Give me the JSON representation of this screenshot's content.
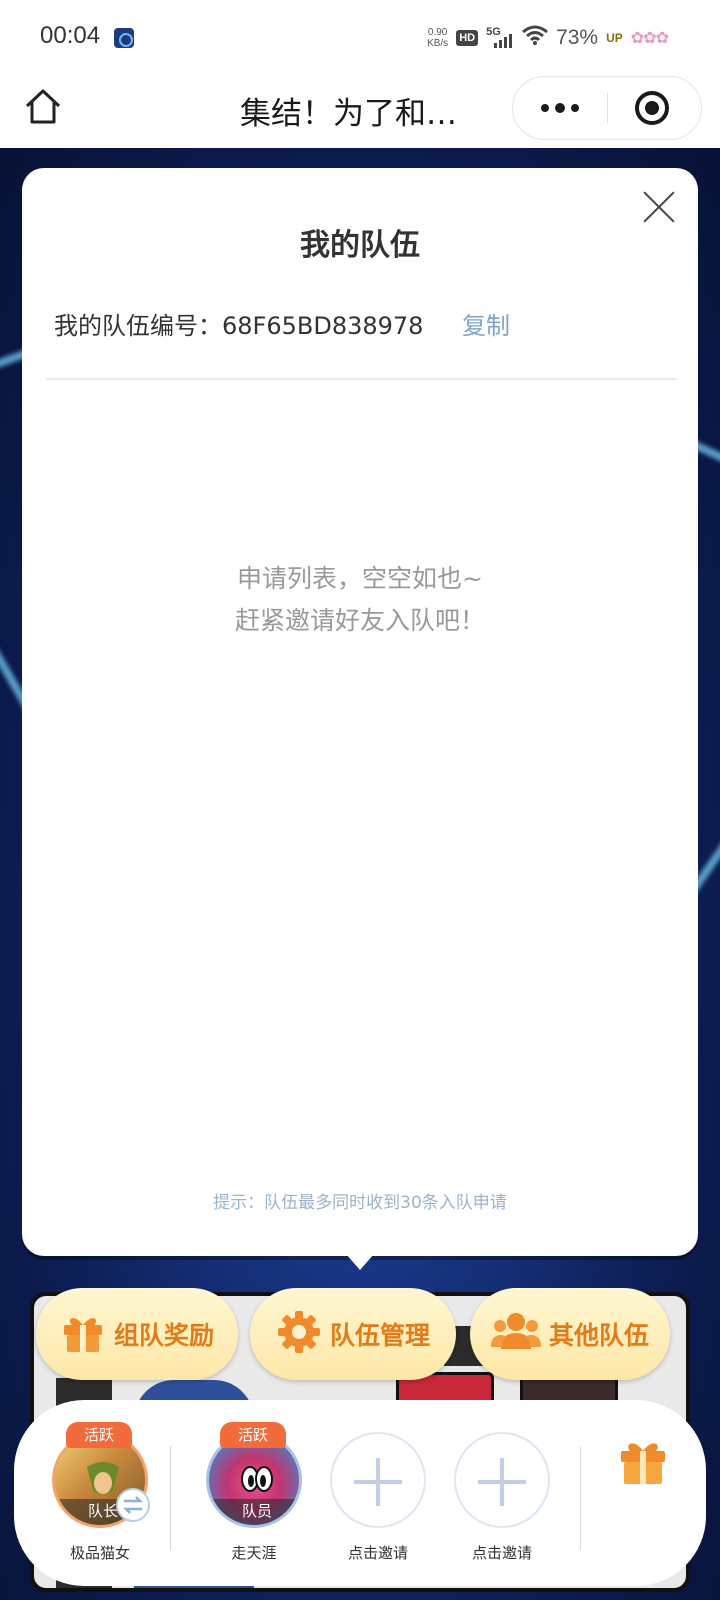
{
  "status_bar": {
    "time": "00:04",
    "net_speed_value": "0.90",
    "net_speed_unit": "KB/s",
    "hd_label": "HD",
    "network_label": "5G",
    "battery": "73%",
    "up_label": "UP"
  },
  "nav": {
    "title": "集结！为了和…",
    "home_icon": "home-icon",
    "more_icon": "more-dots-icon",
    "close_icon": "target-close-icon"
  },
  "modal": {
    "title": "我的队伍",
    "team_number_label": "我的队伍编号：",
    "team_number": "68F65BD838978",
    "copy_label": "复制",
    "empty_line1": "申请列表，空空如也~",
    "empty_line2": "赶紧邀请好友入队吧！",
    "hint": "提示：队伍最多同时收到30条入队申请"
  },
  "actions": [
    {
      "label": "组队奖励",
      "icon": "gift-icon"
    },
    {
      "label": "队伍管理",
      "icon": "gear-icon"
    },
    {
      "label": "其他队伍",
      "icon": "group-icon"
    }
  ],
  "members": [
    {
      "name": "极品猫女",
      "role": "队长",
      "status": "活跃"
    },
    {
      "name": "走天涯",
      "role": "队员",
      "status": "活跃"
    },
    {
      "name": "点击邀请"
    },
    {
      "name": "点击邀请"
    }
  ],
  "colors": {
    "accent_orange": "#e27b1a",
    "copy_blue": "#7fa3cc",
    "active_tag": "#f26b3a"
  }
}
